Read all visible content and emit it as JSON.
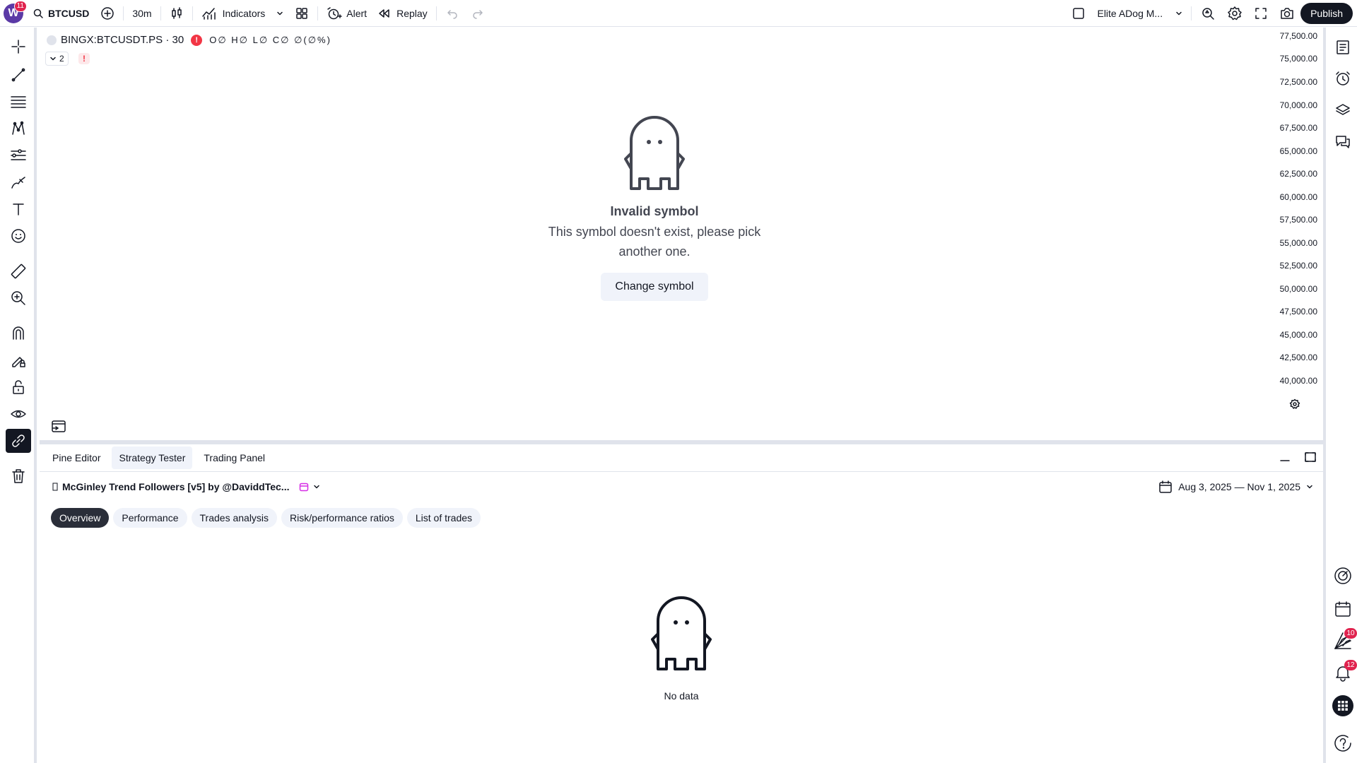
{
  "topbar": {
    "avatar_letter": "W",
    "avatar_badge": "11",
    "symbol": "BTCUSD",
    "interval": "30m",
    "indicators_label": "Indicators",
    "alert_label": "Alert",
    "replay_label": "Replay",
    "layout_name": "Elite ADog M...",
    "publish_label": "Publish"
  },
  "chart": {
    "legend_symbol": "BINGX:BTCUSDT.PS · 30",
    "legend_ohlc": "O∅ H∅ L∅ C∅ ∅(∅%)",
    "collapse_count": "2",
    "warning_mark": "!",
    "error_mark": "!",
    "empty_title": "Invalid symbol",
    "empty_message": "This symbol doesn't exist, please pick another one.",
    "change_symbol_label": "Change symbol",
    "price_axis": [
      "77,500.00",
      "75,000.00",
      "72,500.00",
      "70,000.00",
      "67,500.00",
      "65,000.00",
      "62,500.00",
      "60,000.00",
      "57,500.00",
      "55,000.00",
      "52,500.00",
      "50,000.00",
      "47,500.00",
      "45,000.00",
      "42,500.00",
      "40,000.00"
    ]
  },
  "bottom": {
    "tabs": [
      "Pine Editor",
      "Strategy Tester",
      "Trading Panel"
    ],
    "active_tab": "Strategy Tester",
    "strategy_name": "McGinley Trend Followers [v5] by @DaviddTec...",
    "date_range": "Aug 3, 2025 — Nov 1, 2025",
    "sub_tabs": [
      "Overview",
      "Performance",
      "Trades analysis",
      "Risk/performance ratios",
      "List of trades"
    ],
    "active_sub_tab": "Overview",
    "no_data_text": "No data"
  },
  "rightbar": {
    "badge_1": "10",
    "badge_2": "12"
  },
  "colors": {
    "accent_dark": "#131722",
    "error_red": "#f23645",
    "badge_red": "#e0234e",
    "avatar_purple": "#5b3aa6",
    "strategy_icon_pink": "#d62ee6"
  }
}
